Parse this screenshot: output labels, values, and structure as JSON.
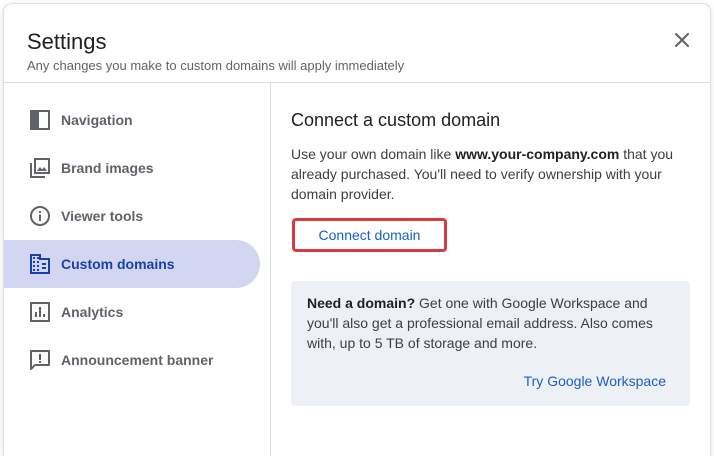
{
  "dialog": {
    "title": "Settings",
    "subtitle": "Any changes you make to custom domains will apply immediately",
    "close_icon": "close-icon"
  },
  "sidebar": {
    "items": [
      {
        "label": "Navigation",
        "icon": "navigation-panel-icon",
        "active": false
      },
      {
        "label": "Brand images",
        "icon": "photo-library-icon",
        "active": false
      },
      {
        "label": "Viewer tools",
        "icon": "info-icon",
        "active": false
      },
      {
        "label": "Custom domains",
        "icon": "domain-icon",
        "active": true
      },
      {
        "label": "Analytics",
        "icon": "analytics-chart-icon",
        "active": false
      },
      {
        "label": "Announcement banner",
        "icon": "announcement-icon",
        "active": false
      }
    ]
  },
  "main": {
    "heading": "Connect a custom domain",
    "desc_prefix": "Use your own domain like ",
    "desc_domain": "www.your-company.com",
    "desc_suffix": " that you already purchased. You'll need to verify ownership with your domain provider.",
    "connect_button": "Connect domain",
    "promo": {
      "bold": "Need a domain?",
      "text": " Get one with Google Workspace and you'll also get a professional email address. Also comes with, up to 5 TB of storage and more.",
      "link": "Try Google Workspace"
    }
  },
  "colors": {
    "accent": "#1a5fc4",
    "active_bg": "#d2d6f0",
    "active_text": "#1a3fa8",
    "highlight_border": "#d93a3f",
    "promo_bg": "#edf0f5"
  }
}
